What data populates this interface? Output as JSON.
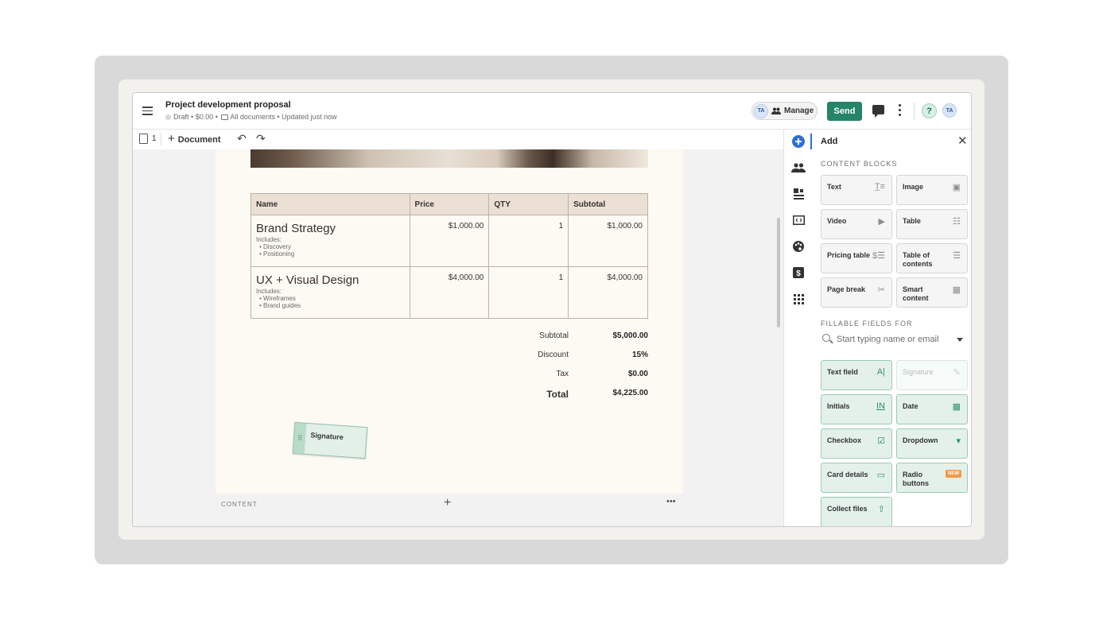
{
  "document": {
    "title": "Project development proposal",
    "status": "Draft",
    "amount": "$0.00",
    "folder": "All documents",
    "updated": "Updated just now",
    "sep": "•"
  },
  "header": {
    "avatar_initials": "TA",
    "manage_label": "Manage",
    "send_label": "Send",
    "help_label": "?"
  },
  "toolbar": {
    "page_count": "1",
    "add_document_label": "Document",
    "undo_icon": "↶",
    "redo_icon": "↷"
  },
  "pricing_table": {
    "columns": [
      "Name",
      "Price",
      "QTY",
      "Subtotal"
    ],
    "rows": [
      {
        "name": "Brand Strategy",
        "includes_label": "Includes:",
        "includes": [
          "Discovery",
          "Positioning"
        ],
        "price": "$1,000.00",
        "qty": "1",
        "subtotal": "$1,000.00"
      },
      {
        "name": "UX + Visual Design",
        "includes_label": "Includes:",
        "includes": [
          "Wireframes",
          "Brand guides"
        ],
        "price": "$4,000.00",
        "qty": "1",
        "subtotal": "$4,000.00"
      }
    ],
    "totals": [
      {
        "label": "Subtotal",
        "value": "$5,000.00"
      },
      {
        "label": "Discount",
        "value": "15%"
      },
      {
        "label": "Tax",
        "value": "$0.00"
      },
      {
        "label": "Total",
        "value": "$4,225.00"
      }
    ]
  },
  "signature_block": {
    "label": "Signature",
    "grip": "⠿"
  },
  "content_bar": {
    "label": "CONTENT",
    "plus": "+",
    "more": "•••"
  },
  "panel": {
    "title": "Add",
    "close": "✕",
    "content_blocks_label": "CONTENT BLOCKS",
    "content_blocks": [
      {
        "label": "Text",
        "icon": "T̲≡"
      },
      {
        "label": "Image",
        "icon": "▣"
      },
      {
        "label": "Video",
        "icon": "▶"
      },
      {
        "label": "Table",
        "icon": "☷"
      },
      {
        "label": "Pricing table",
        "icon": "$☰"
      },
      {
        "label": "Table of contents",
        "icon": "☰"
      },
      {
        "label": "Page break",
        "icon": "✂"
      },
      {
        "label": "Smart content",
        "icon": "▦"
      }
    ],
    "fillable_label": "FILLABLE FIELDS FOR",
    "search_placeholder": "Start typing name or email",
    "fillable_fields": [
      {
        "label": "Text field",
        "icon": "A|"
      },
      {
        "label": "Signature",
        "icon": "✎"
      },
      {
        "label": "Initials",
        "icon": "IN"
      },
      {
        "label": "Date",
        "icon": "▦"
      },
      {
        "label": "Checkbox",
        "icon": "☑"
      },
      {
        "label": "Dropdown",
        "icon": "▾"
      },
      {
        "label": "Card details",
        "icon": "▭"
      },
      {
        "label": "Radio buttons",
        "badge": "NEW"
      },
      {
        "label": "Collect files",
        "icon": "⇧"
      }
    ]
  },
  "rail": {
    "icons": [
      "add-icon",
      "recipients-icon",
      "blocks-icon",
      "embed-icon",
      "palette-icon",
      "pricing-icon",
      "apps-icon"
    ]
  }
}
